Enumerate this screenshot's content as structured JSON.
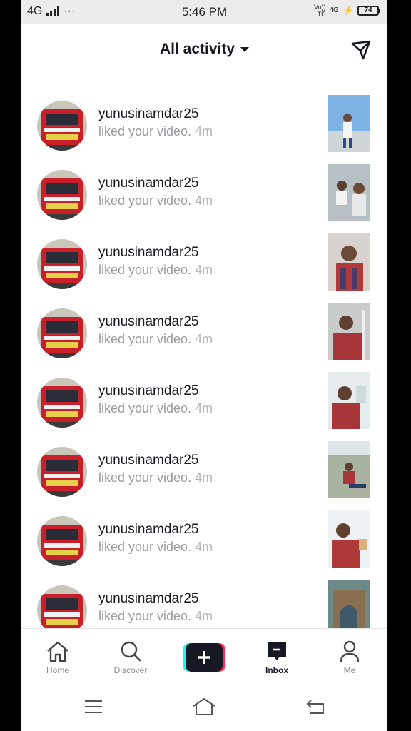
{
  "status_bar": {
    "network": "4G",
    "dots": "···",
    "time": "5:46 PM",
    "volte": "Vo))",
    "lte": "LTE",
    "network2": "4G",
    "battery": "74"
  },
  "header": {
    "title": "All activity",
    "icons": [
      "dropdown-caret-icon",
      "send-icon"
    ]
  },
  "activity": [
    {
      "username": "yunusinamdar25",
      "text": "liked your video.",
      "time": "4m",
      "thumb_bg": "#7fb3e6"
    },
    {
      "username": "yunusinamdar25",
      "text": "liked your video.",
      "time": "4m",
      "thumb_bg": "#b7c0c4"
    },
    {
      "username": "yunusinamdar25",
      "text": "liked your video.",
      "time": "4m",
      "thumb_bg": "#d9d3cf"
    },
    {
      "username": "yunusinamdar25",
      "text": "liked your video.",
      "time": "4m",
      "thumb_bg": "#c9cccb"
    },
    {
      "username": "yunusinamdar25",
      "text": "liked your video.",
      "time": "4m",
      "thumb_bg": "#e6ecee"
    },
    {
      "username": "yunusinamdar25",
      "text": "liked your video.",
      "time": "4m",
      "thumb_bg": "#a9b4a0"
    },
    {
      "username": "yunusinamdar25",
      "text": "liked your video.",
      "time": "4m",
      "thumb_bg": "#eef2f4"
    },
    {
      "username": "yunusinamdar25",
      "text": "liked your video.",
      "time": "4m",
      "thumb_bg": "#6e8a86"
    }
  ],
  "bottom_nav": {
    "items": [
      {
        "label": "Home",
        "icon": "home-icon"
      },
      {
        "label": "Discover",
        "icon": "search-icon"
      },
      {
        "label": "",
        "icon": "create-plus-icon"
      },
      {
        "label": "Inbox",
        "icon": "inbox-icon"
      },
      {
        "label": "Me",
        "icon": "profile-icon"
      }
    ],
    "active": "Inbox"
  },
  "system_nav": {
    "icons": [
      "menu-icon",
      "home-outline-icon",
      "back-icon"
    ]
  },
  "colors": {
    "text_primary": "#161823",
    "text_secondary": "#9a9ba0",
    "plus_cyan": "#25f4ee",
    "plus_pink": "#fe2c55"
  }
}
